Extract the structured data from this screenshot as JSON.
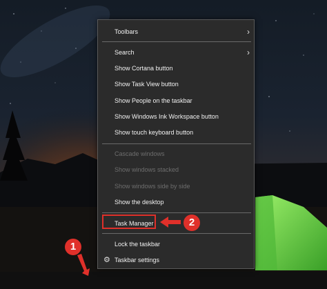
{
  "menu": {
    "toolbars_label": "Toolbars",
    "search_label": "Search",
    "show_cortana_label": "Show Cortana button",
    "show_task_view_label": "Show Task View button",
    "show_people_label": "Show People on the taskbar",
    "show_ink_label": "Show Windows Ink Workspace button",
    "show_keyboard_label": "Show touch keyboard button",
    "cascade_label": "Cascade windows",
    "stacked_label": "Show windows stacked",
    "side_by_side_label": "Show windows side by side",
    "show_desktop_label": "Show the desktop",
    "task_manager_label": "Task Manager",
    "lock_taskbar_label": "Lock the taskbar",
    "taskbar_settings_label": "Taskbar settings"
  },
  "annotations": {
    "step1": "1",
    "step2": "2",
    "highlight_color": "#e0302a"
  },
  "icons": {
    "submenu": "chevron-right-icon",
    "settings": "gear-icon"
  }
}
